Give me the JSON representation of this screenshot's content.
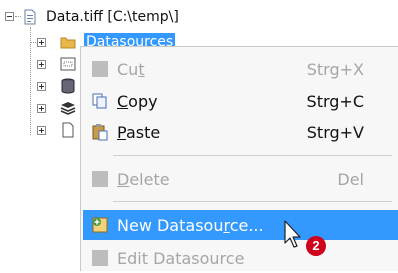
{
  "tree": {
    "root_label": "Data.tiff [C:\\temp\\]",
    "child_label": "Datasources"
  },
  "menu": {
    "items": [
      {
        "label_pre": "Cu",
        "label_ul": "t",
        "label_post": "",
        "shortcut": "Strg+X",
        "icon": "scissors-icon",
        "enabled": false
      },
      {
        "label_pre": "",
        "label_ul": "C",
        "label_post": "opy",
        "shortcut": "Strg+C",
        "icon": "copy-icon",
        "enabled": true
      },
      {
        "label_pre": "",
        "label_ul": "P",
        "label_post": "aste",
        "shortcut": "Strg+V",
        "icon": "paste-icon",
        "enabled": true
      },
      {
        "label_pre": "",
        "label_ul": "D",
        "label_post": "elete",
        "shortcut": "Del",
        "icon": "delete-icon",
        "enabled": false
      },
      {
        "label_pre": "New Datasou",
        "label_ul": "r",
        "label_post": "ce...",
        "shortcut": "",
        "icon": "new-datasource-icon",
        "enabled": true,
        "highlighted": true
      },
      {
        "label_pre": "Edit Datasource",
        "label_ul": "",
        "label_post": "",
        "shortcut": "",
        "icon": "edit-datasource-icon",
        "enabled": false
      }
    ]
  },
  "annotation": {
    "badge": "2"
  },
  "colors": {
    "highlight": "#3399ff",
    "badge": "#d0021b",
    "disabled": "#a6a6a6"
  }
}
